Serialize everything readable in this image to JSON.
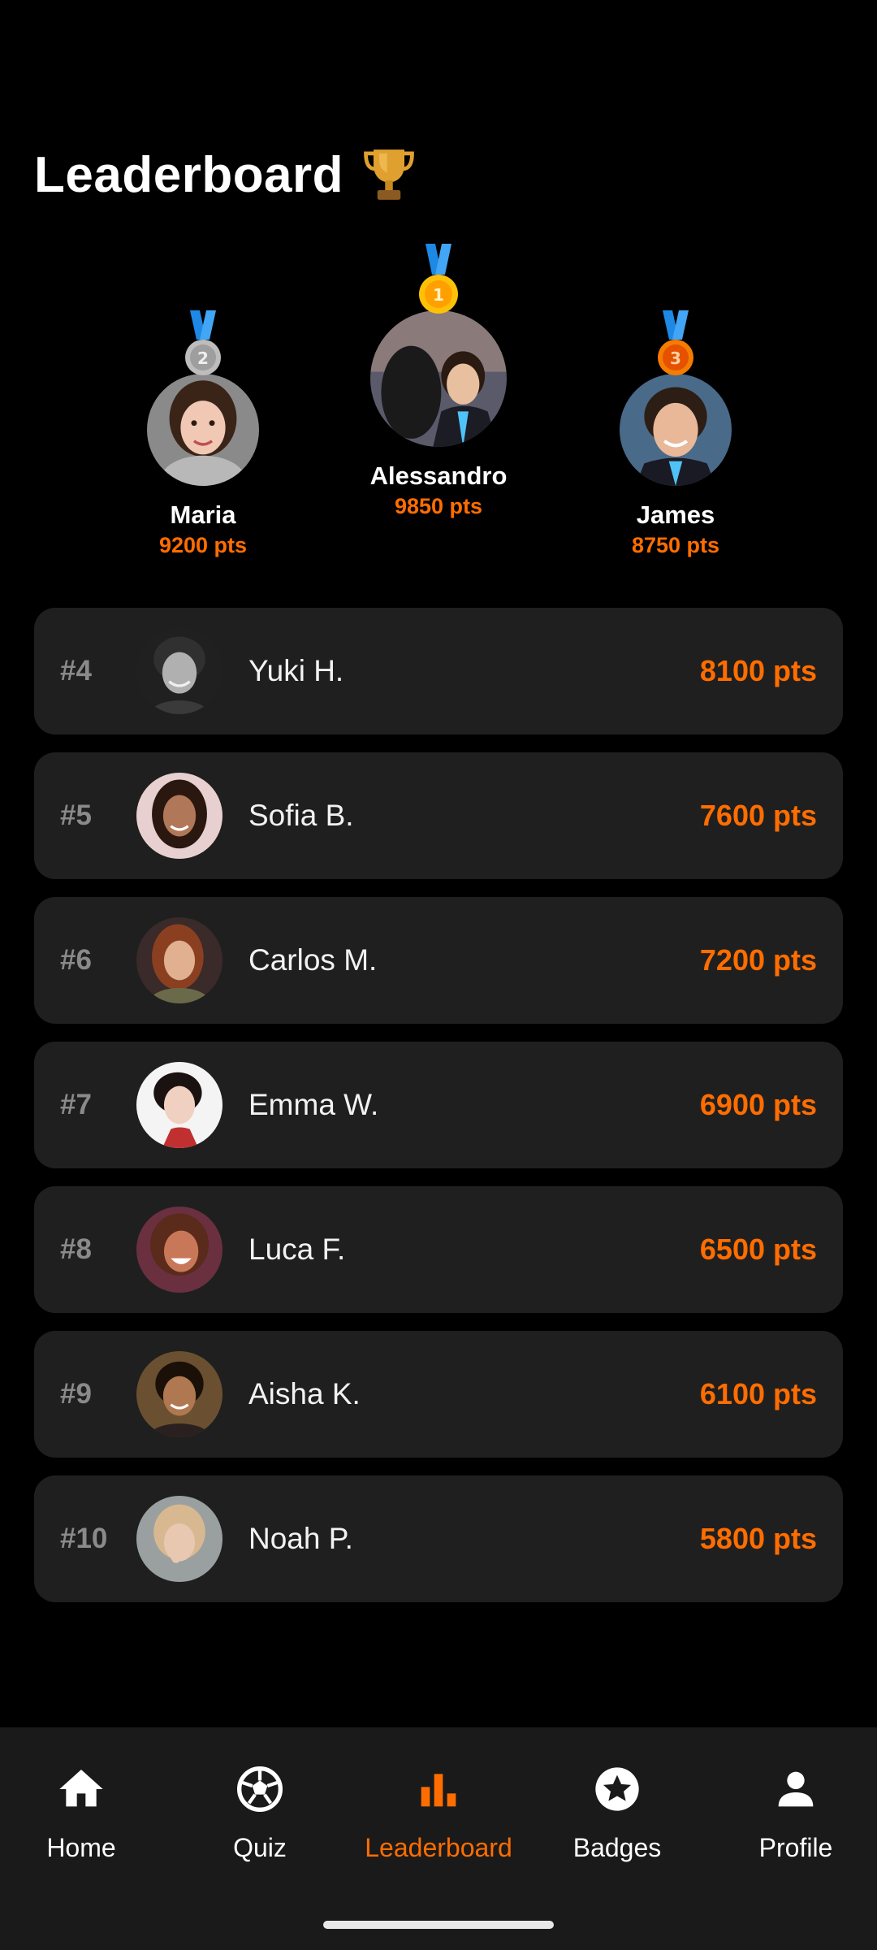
{
  "header": {
    "title": "Leaderboard"
  },
  "podium": [
    {
      "place": 2,
      "name": "Maria",
      "points": "9200 pts",
      "medal_color": "#C0C0C0",
      "skin": "#f0c8b4",
      "hair": "#3a2418",
      "bg": "#8a8a8a"
    },
    {
      "place": 1,
      "name": "Alessandro",
      "points": "9850 pts",
      "medal_color": "#FFC107",
      "skin": "#e8c0a0",
      "hair": "#2a1a12",
      "bg": "#5a5a6a"
    },
    {
      "place": 3,
      "name": "James",
      "points": "8750 pts",
      "medal_color": "#F57C00",
      "skin": "#e8b898",
      "hair": "#2c1e14",
      "bg": "#4a6a8a"
    }
  ],
  "rows": [
    {
      "rank": "#4",
      "name": "Yuki H.",
      "points": "8100 pts",
      "skin": "#b0b0b0",
      "hair": "#303030",
      "bg": "#202020"
    },
    {
      "rank": "#5",
      "name": "Sofia B.",
      "points": "7600 pts",
      "skin": "#b07858",
      "hair": "#2a1810",
      "bg": "#e8d0d0"
    },
    {
      "rank": "#6",
      "name": "Carlos M.",
      "points": "7200 pts",
      "skin": "#e0b090",
      "hair": "#8a4020",
      "bg": "#3a2a2a"
    },
    {
      "rank": "#7",
      "name": "Emma W.",
      "points": "6900 pts",
      "skin": "#f0d0c0",
      "hair": "#1a1210",
      "bg": "#f4f4f4"
    },
    {
      "rank": "#8",
      "name": "Luca F.",
      "points": "6500 pts",
      "skin": "#c87858",
      "hair": "#5a2a1a",
      "bg": "#6a3040"
    },
    {
      "rank": "#9",
      "name": "Aisha K.",
      "points": "6100 pts",
      "skin": "#b07850",
      "hair": "#1a1008",
      "bg": "#6a5030"
    },
    {
      "rank": "#10",
      "name": "Noah P.",
      "points": "5800 pts",
      "skin": "#e8c8b0",
      "hair": "#d8b890",
      "bg": "#9aa0a0"
    }
  ],
  "nav": [
    {
      "label": "Home",
      "icon": "home-icon",
      "active": false
    },
    {
      "label": "Quiz",
      "icon": "soccer-ball-icon",
      "active": false
    },
    {
      "label": "Leaderboard",
      "icon": "bar-chart-icon",
      "active": true
    },
    {
      "label": "Badges",
      "icon": "star-badge-icon",
      "active": false
    },
    {
      "label": "Profile",
      "icon": "person-icon",
      "active": false
    }
  ],
  "colors": {
    "accent": "#FF6D00",
    "card": "#1f1f1f",
    "rank_text": "#8a8a8a"
  }
}
